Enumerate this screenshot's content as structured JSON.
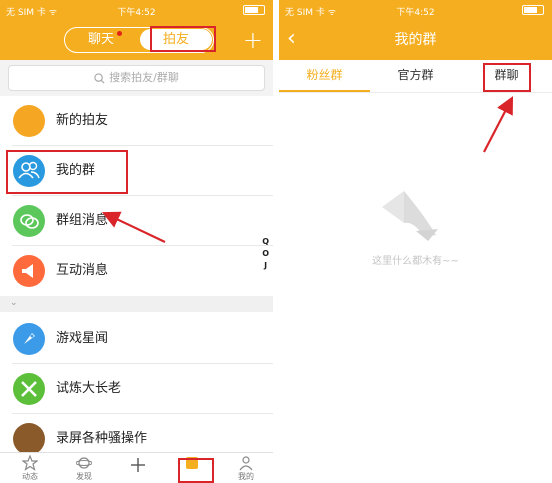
{
  "left": {
    "status": {
      "carrier": "无 SIM 卡 ᯤ",
      "time": "下午4:52"
    },
    "segment": {
      "chat": "聊天",
      "friends": "拍友"
    },
    "search": {
      "placeholder": "搜索拍友/群聊"
    },
    "items": [
      {
        "label": "新的拍友",
        "color": "#f5a623"
      },
      {
        "label": "我的群",
        "color": "#2a9ae0"
      },
      {
        "label": "群组消息",
        "color": "#5cc85c"
      },
      {
        "label": "互动消息",
        "color": "#ff6a3c"
      },
      {
        "label": "游戏星闻",
        "color": "#3b9be8"
      },
      {
        "label": "试炼大长老",
        "color": "#5cbf3a"
      },
      {
        "label": "录屏各种骚操作",
        "color": "#8a5a2a"
      }
    ],
    "divider_label": "⌄",
    "index_letters": "Q\nO\nJ",
    "tabs": [
      {
        "label": "动态"
      },
      {
        "label": "发现"
      },
      {
        "label": ""
      },
      {
        "label": ""
      },
      {
        "label": "我的"
      }
    ]
  },
  "right": {
    "status": {
      "carrier": "无 SIM 卡 ᯤ",
      "time": "下午4:52"
    },
    "title": "我的群",
    "tabs": [
      "粉丝群",
      "官方群",
      "群聊"
    ],
    "empty_text": "这里什么都木有~~"
  },
  "colors": {
    "brand": "#f5ae1f",
    "annotation": "#d9252a"
  }
}
